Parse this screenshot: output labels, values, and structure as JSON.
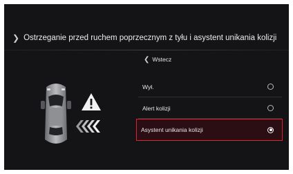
{
  "header": {
    "title": "Ostrzeganie przed ruchem poprzecznym z tyłu i asystent unikania kolizji"
  },
  "back": {
    "label": "Wstecz"
  },
  "menu": {
    "items": [
      {
        "label": "Wył.",
        "selected": false
      },
      {
        "label": "Alert kolizji",
        "selected": false
      },
      {
        "label": "Asystent unikania kolizji",
        "selected": true
      }
    ]
  },
  "colors": {
    "accent": "#e0202e",
    "background": "#141416",
    "text": "#e8e8e8"
  },
  "icons": [
    "chevron-right-icon",
    "chevron-left-icon",
    "car-top-view-icon",
    "warning-triangle-icon",
    "rear-traffic-arrows-icon",
    "radio-icon"
  ]
}
